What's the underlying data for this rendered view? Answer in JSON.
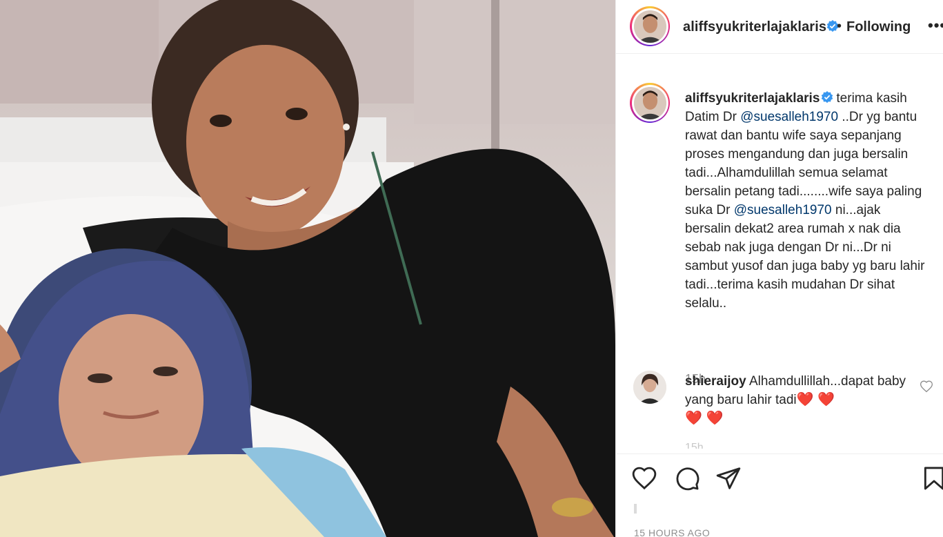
{
  "photo": {
    "alt_subject": "photo"
  },
  "header": {
    "username": "aliffsyukriterlajaklaris",
    "separator": "•",
    "follow_state": "Following",
    "more_label": "•••"
  },
  "caption": {
    "username": "aliffsyukriterlajaklaris",
    "text_1": "terima kasih Datim Dr ",
    "mention_1": "@suesalleh1970",
    "text_2": " ..Dr yg bantu rawat dan bantu wife saya sepanjang proses mengandung dan juga bersalin tadi...Alhamdulillah semua selamat bersalin petang tadi........wife saya paling suka Dr ",
    "mention_2": "@suesalleh1970",
    "text_3": " ni...ajak bersalin dekat2 area rumah x nak dia sebab nak juga dengan Dr ni...Dr ni sambut yusof dan juga baby yg baru lahir tadi...terima kasih mudahan Dr sihat selalu..",
    "time": "15h"
  },
  "comment": {
    "username": "shieraijoy",
    "text": "Alhamdullillah...dapat baby yang baru lahir tadi",
    "hearts_1": "❤️ ❤️",
    "hearts_2": "❤️ ❤️",
    "time_peek": "15h"
  },
  "actions": {
    "posted_time": "15 HOURS AGO"
  },
  "colors": {
    "text": "#262626",
    "muted": "#8e8e8e",
    "mention": "#00376b",
    "verified": "#3897f0",
    "heart": "#e0245e",
    "border": "#efefef"
  },
  "icons": [
    "verified-badge-icon",
    "more-options-icon",
    "like-heart-icon",
    "comment-bubble-icon",
    "share-plane-icon",
    "save-bookmark-icon",
    "comment-like-heart-icon"
  ]
}
